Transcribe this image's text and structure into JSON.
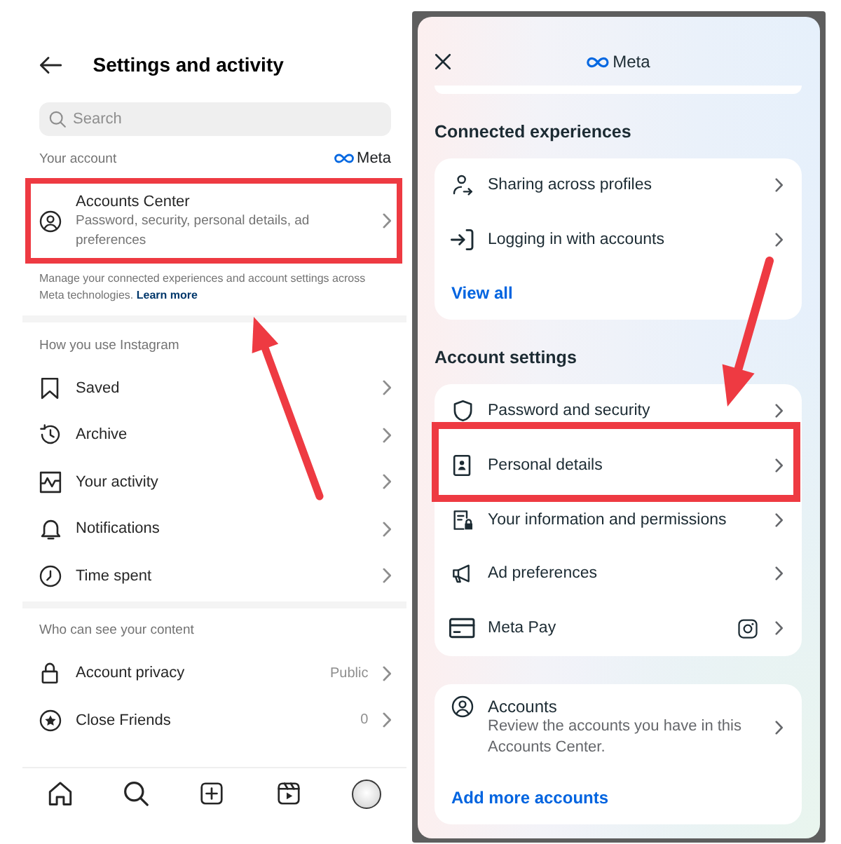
{
  "left": {
    "title": "Settings and activity",
    "search": {
      "placeholder": "Search"
    },
    "sections": [
      {
        "heading": "Your account",
        "brand": "Meta",
        "items": [
          {
            "label": "Accounts Center",
            "subtitle": "Password, security, personal details, ad preferences",
            "highlighted": true
          }
        ],
        "note": "Manage your connected experiences and account settings across Meta technologies.",
        "note_link": "Learn more"
      },
      {
        "heading": "How you use Instagram",
        "items": [
          {
            "label": "Saved",
            "highlighted": false
          },
          {
            "label": "Archive",
            "highlighted": false
          },
          {
            "label": "Your activity",
            "highlighted": false
          },
          {
            "label": "Notifications",
            "highlighted": false
          },
          {
            "label": "Time spent",
            "highlighted": false
          }
        ]
      },
      {
        "heading": "Who can see your content",
        "items": [
          {
            "label": "Account privacy",
            "value": "Public",
            "highlighted": false
          },
          {
            "label": "Close Friends",
            "value": "0",
            "highlighted": false
          }
        ]
      }
    ]
  },
  "right": {
    "brand": "Meta",
    "sections": [
      {
        "heading": "Connected experiences",
        "items": [
          {
            "label": "Sharing across profiles",
            "highlighted": false
          },
          {
            "label": "Logging in with accounts",
            "highlighted": false
          }
        ],
        "link": "View all"
      },
      {
        "heading": "Account settings",
        "items": [
          {
            "kind": "plain",
            "label": "Password and security",
            "highlighted": false
          },
          {
            "kind": "plain",
            "label": "Personal details",
            "highlighted": true
          },
          {
            "kind": "plain",
            "label": "Your information and permissions",
            "highlighted": false
          },
          {
            "kind": "plain",
            "label": "Ad preferences",
            "highlighted": false
          },
          {
            "kind": "linked-app",
            "label": "Meta Pay",
            "highlighted": false
          }
        ]
      }
    ],
    "accounts_card": {
      "title": "Accounts",
      "subtitle": "Review the accounts you have in this Accounts Center.",
      "link": "Add more accounts"
    }
  }
}
